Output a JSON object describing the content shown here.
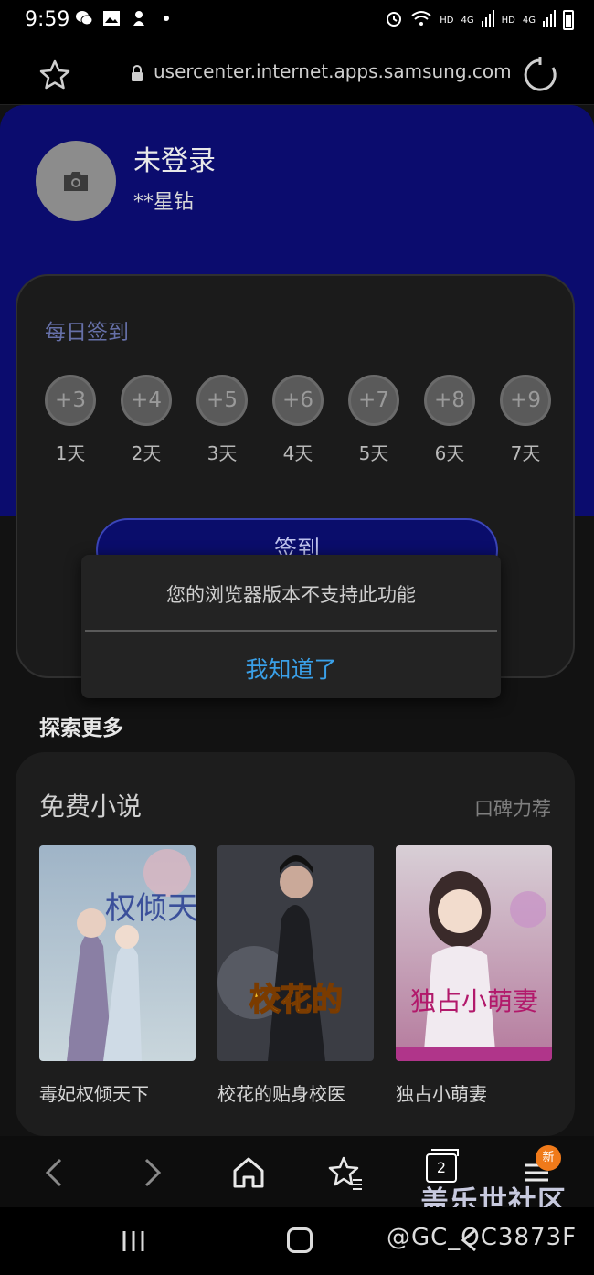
{
  "status_bar": {
    "time": "9:59",
    "signal_1_label": "HD",
    "network_1": "4G",
    "signal_2_label": "HD",
    "network_2": "4G"
  },
  "url_bar": {
    "url": "usercenter.internet.apps.samsung.com"
  },
  "profile": {
    "name": "未登录",
    "subtitle": "**星钻"
  },
  "checkin": {
    "title": "每日签到",
    "days": [
      {
        "reward": "+3",
        "label": "1天"
      },
      {
        "reward": "+4",
        "label": "2天"
      },
      {
        "reward": "+5",
        "label": "3天"
      },
      {
        "reward": "+6",
        "label": "4天"
      },
      {
        "reward": "+7",
        "label": "5天"
      },
      {
        "reward": "+8",
        "label": "6天"
      },
      {
        "reward": "+9",
        "label": "7天"
      }
    ],
    "button_label": "签到"
  },
  "explore": {
    "title": "探索更多"
  },
  "novels": {
    "title": "免费小说",
    "tag": "口碑力荐",
    "books": [
      {
        "name": "毒妃权倾天下",
        "cover_text": "权倾天下"
      },
      {
        "name": "校花的贴身校医",
        "cover_text": "校花的"
      },
      {
        "name": "独占小萌妻",
        "cover_text": "独占小萌妻"
      }
    ]
  },
  "dialog": {
    "message": "您的浏览器版本不支持此功能",
    "confirm_label": "我知道了"
  },
  "toolbar": {
    "tabs_count": "2",
    "badge_label": "新"
  },
  "watermark": {
    "line1": "盖乐世社区",
    "line2": "@GC_OC3873F"
  },
  "colors": {
    "hero_bg": "#0b0c6e",
    "link_blue": "#3aa0e8",
    "badge_orange": "#f07a1a",
    "checkin_title": "#6670a8"
  }
}
